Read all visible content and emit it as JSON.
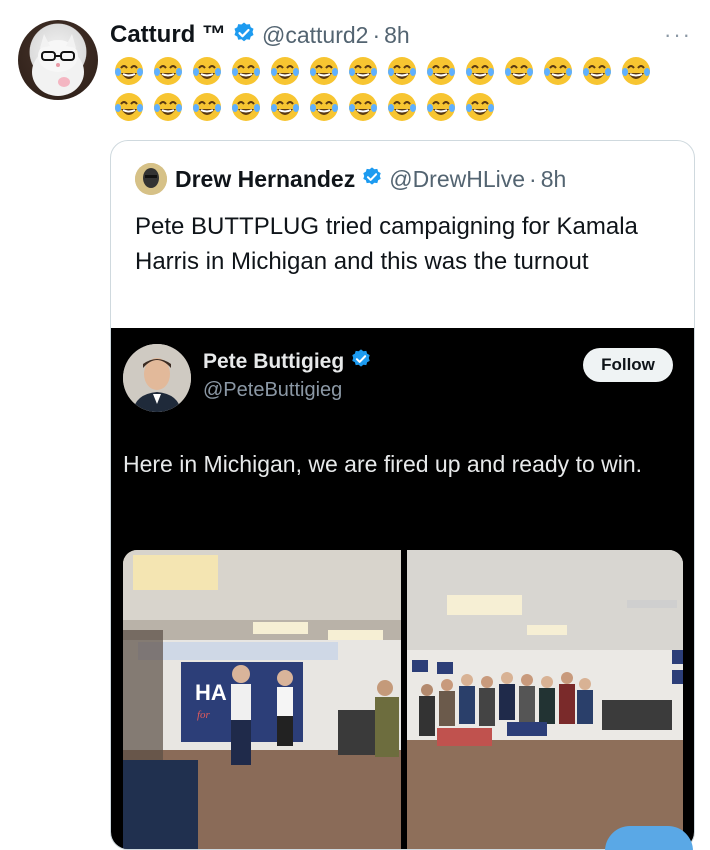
{
  "tweet": {
    "author_name": "Catturd ™",
    "handle": "@catturd2",
    "separator": "·",
    "time": "8h",
    "emoji_row1": [
      "😂",
      "😂",
      "😂",
      "😂",
      "😂",
      "😂",
      "😂",
      "😂",
      "😂",
      "😂",
      "😂",
      "😂",
      "😂",
      "😂"
    ],
    "emoji_row2": [
      "😂",
      "😂",
      "😂",
      "😂",
      "😂",
      "😂",
      "😂",
      "😂",
      "😂",
      "😂"
    ],
    "more_icon": "more-icon"
  },
  "quoted": {
    "author_name": "Drew Hernandez",
    "handle": "@DrewHLive",
    "separator": "·",
    "time": "8h",
    "text": "Pete BUTTPLUG tried campaigning for Kamala Harris in Michigan and this was the turnout"
  },
  "embedded": {
    "author_name": "Pete Buttigieg",
    "handle": "@PeteButtigieg",
    "follow_label": "Follow",
    "text": "Here in Michigan, we are fired up and ready to win.",
    "left_photo_sign": "HA",
    "left_photo_sign_sub": "for"
  },
  "colors": {
    "verified": "#1d9bf0",
    "muted": "#536471",
    "dark_bg": "#000000"
  }
}
